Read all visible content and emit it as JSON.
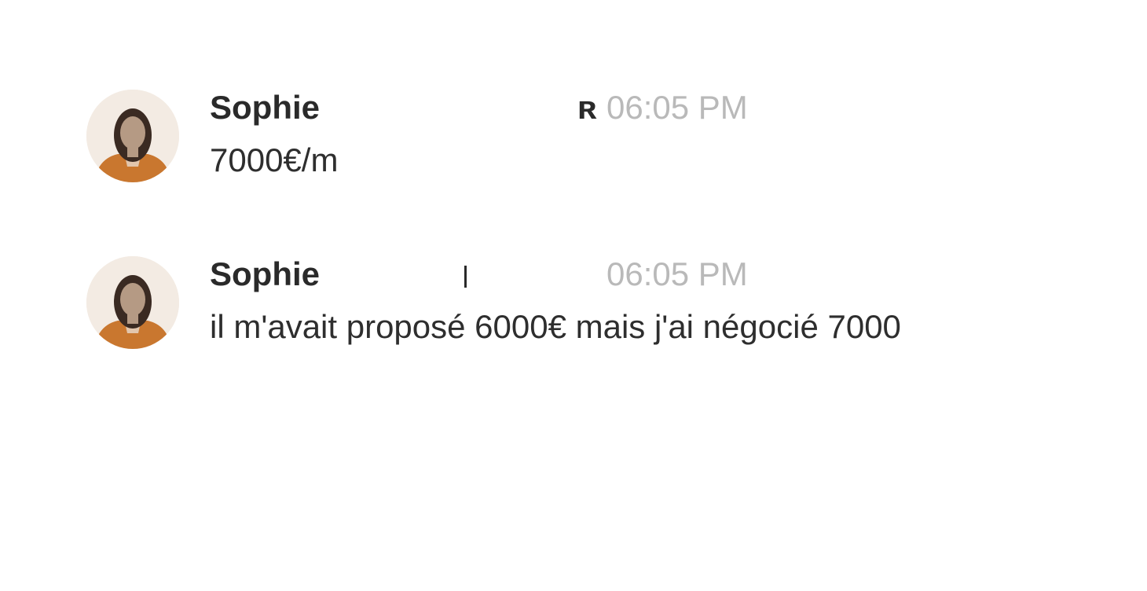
{
  "messages": [
    {
      "sender": "Sophie",
      "time": "06:05 PM",
      "text": "7000€/m",
      "avatar": "user-photo-avatar"
    },
    {
      "sender": "Sophie",
      "time": "06:05 PM",
      "text": "il m'avait proposé 6000€ mais j'ai négocié 7000",
      "avatar": "user-photo-avatar"
    }
  ],
  "colors": {
    "sender": "#2a2a2a",
    "timestamp": "#b9b9b9",
    "text": "#2e2e2e",
    "background": "#ffffff"
  }
}
